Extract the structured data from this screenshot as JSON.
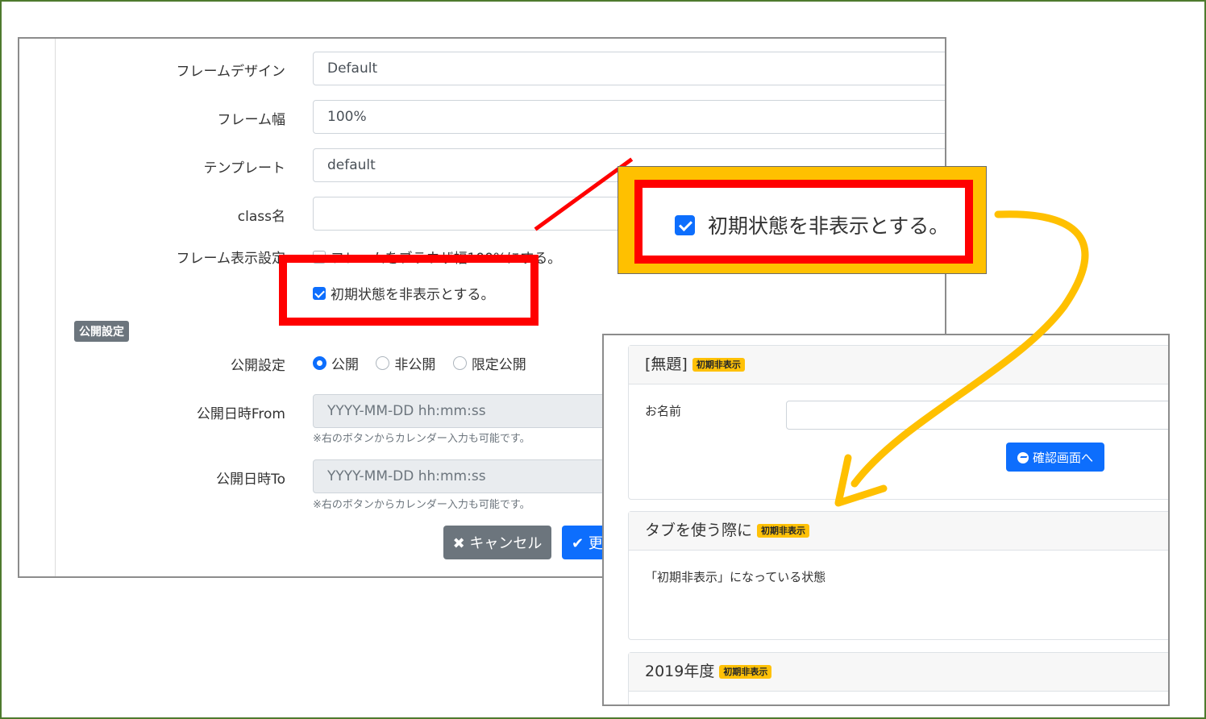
{
  "settings": {
    "frame_design_label": "フレームデザイン",
    "frame_design_value": "Default",
    "frame_width_label": "フレーム幅",
    "frame_width_value": "100%",
    "template_label": "テンプレート",
    "template_value": "default",
    "class_label": "class名",
    "class_value": "",
    "frame_display_label": "フレーム表示設定",
    "browser_width_option": "フレームをブラウザ幅100%にする。",
    "browser_width_checked": false,
    "hide_initial_option": "初期状態を非表示とする。",
    "hide_initial_checked": true,
    "publish_section_badge": "公開設定",
    "publish_label": "公開設定",
    "publish_options": [
      "公開",
      "非公開",
      "限定公開"
    ],
    "publish_selected": "公開",
    "from_label": "公開日時From",
    "from_placeholder": "YYYY-MM-DD hh:mm:ss",
    "from_help": "※右のボタンからカレンダー入力も可能です。",
    "to_label": "公開日時To",
    "to_placeholder": "YYYY-MM-DD hh:mm:ss",
    "to_help": "※右のボタンからカレンダー入力も可能です。",
    "cancel_label": "キャンセル",
    "update_label": "更"
  },
  "callout": {
    "text": "初期状態を非表示とする。"
  },
  "result": {
    "cards": [
      {
        "title": "[無題]",
        "badge": "初期非表示"
      },
      {
        "title": "タブを使う際に",
        "badge": "初期非表示"
      },
      {
        "title": "2019年度",
        "badge": "初期非表示"
      }
    ],
    "name_label": "お名前",
    "confirm_button": "確認画面へ",
    "tab_text": "「初期非表示」になっている状態"
  },
  "colors": {
    "highlight_red": "#ff0000",
    "callout_yellow": "#ffc000",
    "primary_blue": "#0d6efd",
    "secondary_gray": "#6c757d",
    "badge_yellow": "#ffc107",
    "outer_border_green": "#4e7a2e"
  }
}
